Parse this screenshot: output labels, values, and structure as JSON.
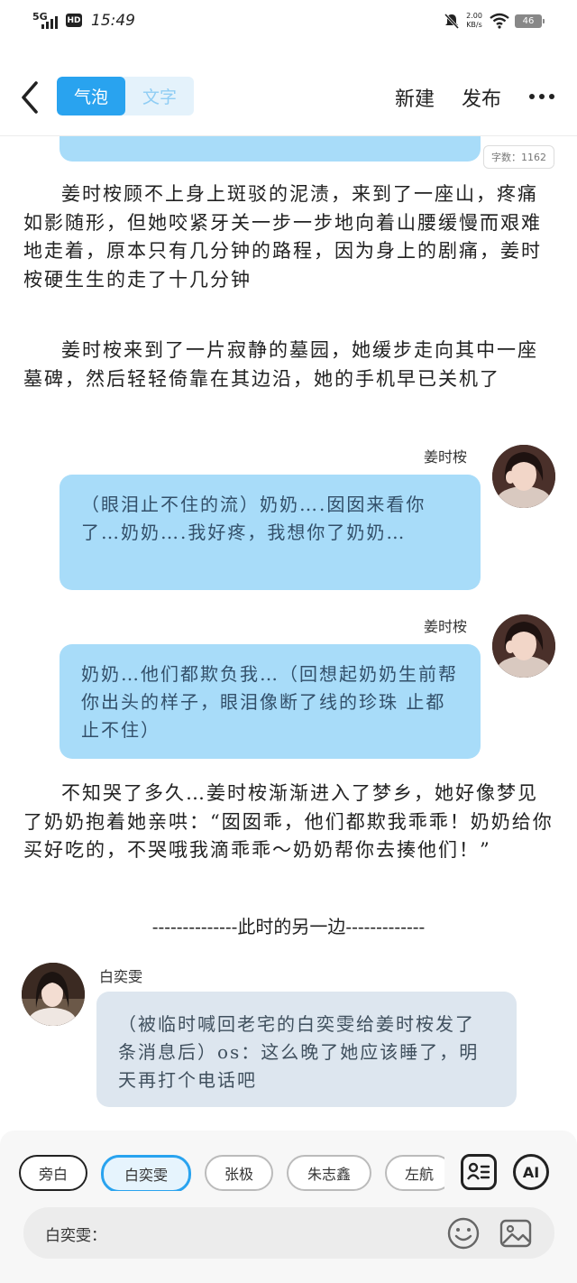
{
  "status_bar": {
    "network": "5G",
    "hd": "HD",
    "time": "15:49",
    "speed": "2.00\nKB/s",
    "battery": "46"
  },
  "header": {
    "tabs": [
      {
        "label": "气泡",
        "active": true
      },
      {
        "label": "文字",
        "active": false
      }
    ],
    "new_label": "新建",
    "publish_label": "发布"
  },
  "content": {
    "word_count": "字数：1162",
    "paragraphs": [
      "姜时桉顾不上身上斑驳的泥渍，来到了一座山，疼痛如影随形，但她咬紧牙关一步一步地向着山腰缓慢而艰难地走着，原本只有几分钟的路程，因为身上的剧痛，姜时桉硬生生的走了十几分钟",
      "姜时桉来到了一片寂静的墓园，她缓步走向其中一座墓碑，然后轻轻倚靠在其边沿，她的手机早已关机了"
    ],
    "messages": [
      {
        "name": "姜时桉",
        "text": "（眼泪止不住的流）奶奶….囡囡来看你了…奶奶….我好疼，我想你了奶奶…"
      },
      {
        "name": "姜时桉",
        "text": "奶奶…他们都欺负我…（回想起奶奶生前帮你出头的样子，眼泪像断了线的珍珠 止都止不住）"
      }
    ],
    "paragraph_3": "不知哭了多久…姜时桉渐渐进入了梦乡，她好像梦见了奶奶抱着她亲哄：“囡囡乖，他们都欺我乖乖！奶奶给你买好吃的，不哭哦我滴乖乖～奶奶帮你去揍他们！”",
    "divider": "--------------此时的另一边-------------",
    "left_message": {
      "name": "白奕雯",
      "text": "（被临时喊回老宅的白奕雯给姜时桉发了条消息后）os：这么晚了她应该睡了，明天再打个电话吧"
    }
  },
  "bottom": {
    "chips": [
      "旁白",
      "白奕雯",
      "张极",
      "朱志鑫",
      "左航"
    ],
    "selected_chip": "白奕雯",
    "ai_label": "AI",
    "input_label": "白奕雯："
  },
  "colors": {
    "accent": "#29a3ef",
    "bubble_blue": "#a8dcf9",
    "bubble_gray": "#dde6ef"
  }
}
